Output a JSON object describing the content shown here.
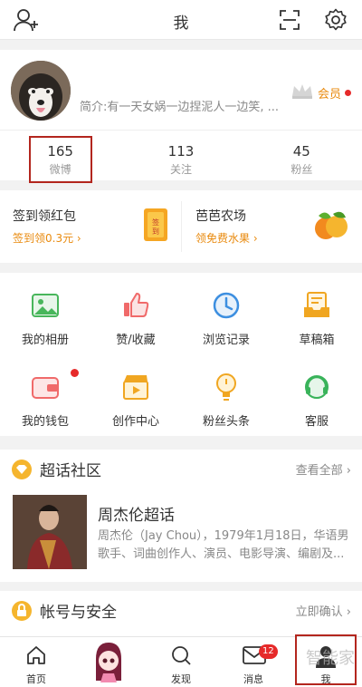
{
  "header": {
    "title": "我"
  },
  "profile": {
    "bio": "简介:有一天女娲一边捏泥人一边笑, ...",
    "vip_label": "会员"
  },
  "stats": [
    {
      "count": "165",
      "label": "微博"
    },
    {
      "count": "113",
      "label": "关注"
    },
    {
      "count": "45",
      "label": "粉丝"
    }
  ],
  "promo": [
    {
      "title": "签到领红包",
      "subtitle": "签到领0.3元 ›",
      "icon": "sign-in-card-icon"
    },
    {
      "title": "芭芭农场",
      "subtitle": "领免费水果 ›",
      "icon": "fruit-icon"
    }
  ],
  "grid": [
    {
      "label": "我的相册",
      "icon": "album-icon"
    },
    {
      "label": "赞/收藏",
      "icon": "thumbs-up-icon"
    },
    {
      "label": "浏览记录",
      "icon": "history-clock-icon"
    },
    {
      "label": "草稿箱",
      "icon": "drafts-icon"
    },
    {
      "label": "我的钱包",
      "icon": "wallet-icon"
    },
    {
      "label": "创作中心",
      "icon": "film-icon"
    },
    {
      "label": "粉丝头条",
      "icon": "bulb-icon"
    },
    {
      "label": "客服",
      "icon": "headset-icon"
    }
  ],
  "super_topic": {
    "header": "超话社区",
    "view_all": "查看全部 ›",
    "topic_title": "周杰伦超话",
    "topic_desc": "周杰伦（Jay Chou），1979年1月18日，华语男歌手、词曲创作人、演员、电影导演、编剧及..."
  },
  "account": {
    "header": "帐号与安全",
    "action": "立即确认 ›"
  },
  "tabbar": [
    {
      "label": "首页",
      "icon": "home-icon"
    },
    {
      "label": "",
      "icon": "mascot-icon"
    },
    {
      "label": "发现",
      "icon": "search-icon"
    },
    {
      "label": "消息",
      "icon": "mail-icon",
      "badge": "12"
    },
    {
      "label": "我",
      "icon": "user-icon"
    }
  ],
  "watermark": "智能家",
  "colors": {
    "accent": "#e98a0e",
    "highlight_box": "#b3261e",
    "badge": "#e62a2a"
  }
}
